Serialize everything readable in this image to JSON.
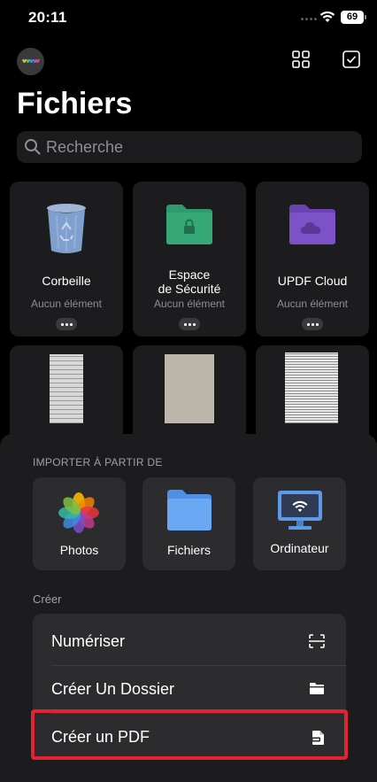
{
  "status": {
    "time": "20:11",
    "battery": "69"
  },
  "header": {
    "title": "Fichiers"
  },
  "search": {
    "placeholder": "Recherche"
  },
  "cards": [
    {
      "label": "Corbeille",
      "sub": "Aucun élément",
      "icon": "trash-icon"
    },
    {
      "label": "Espace\nde Sécurité",
      "sub": "Aucun élément",
      "icon": "lock-folder-icon"
    },
    {
      "label": "UPDF Cloud",
      "sub": "Aucun élément",
      "icon": "cloud-folder-icon"
    }
  ],
  "import": {
    "title": "IMPORTER À PARTIR DE",
    "items": [
      {
        "label": "Photos",
        "icon": "photos-icon"
      },
      {
        "label": "Fichiers",
        "icon": "files-folder-icon"
      },
      {
        "label": "Ordinateur",
        "icon": "computer-wifi-icon"
      }
    ]
  },
  "create": {
    "title": "Créer",
    "items": [
      {
        "label": "Numériser",
        "icon": "scan-icon"
      },
      {
        "label": "Créer Un Dossier",
        "icon": "folder-icon"
      },
      {
        "label": "Créer un PDF",
        "icon": "pdf-file-icon"
      }
    ]
  },
  "colors": {
    "accent": "#e3232f",
    "folder_green": "#2f9a6d",
    "folder_purple": "#7b4fc9",
    "folder_blue": "#5aa3f0"
  }
}
